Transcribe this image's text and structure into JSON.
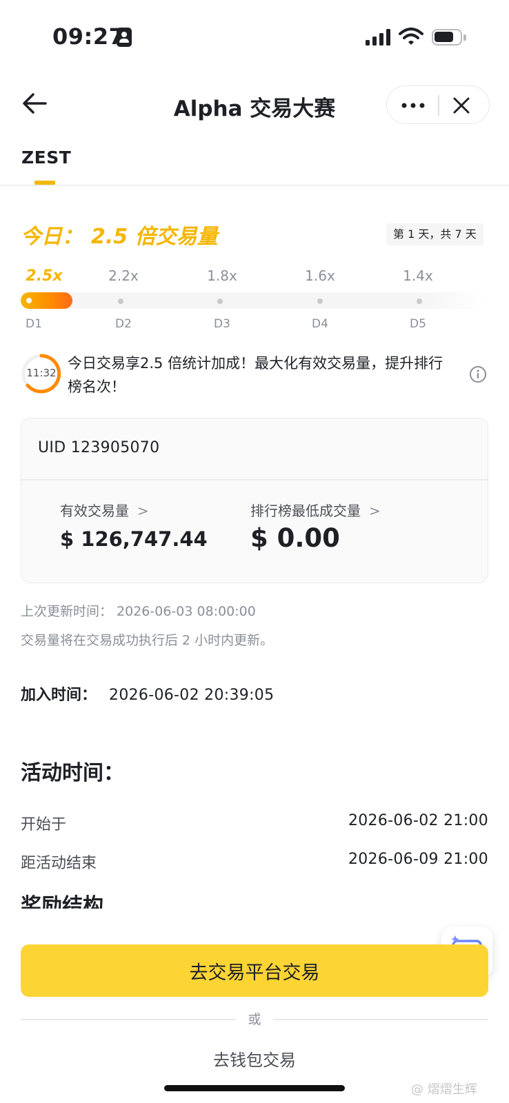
{
  "status_bar": {
    "time": "09:27"
  },
  "nav": {
    "title": "Alpha 交易大赛"
  },
  "tabs": [
    {
      "label": "ZEST",
      "active": true
    }
  ],
  "today": {
    "label": "今日：",
    "multiplier": "2.5 倍交易量",
    "day_badge": "第 1 天，共 7 天",
    "progress": 0.11
  },
  "steps": [
    {
      "mult": "2.5x",
      "day": "D1",
      "active": true
    },
    {
      "mult": "2.2x",
      "day": "D2",
      "active": false
    },
    {
      "mult": "1.8x",
      "day": "D3",
      "active": false
    },
    {
      "mult": "1.6x",
      "day": "D4",
      "active": false
    },
    {
      "mult": "1.4x",
      "day": "D5",
      "active": false
    }
  ],
  "notice": {
    "timer": "11:32",
    "text": "今日交易享2.5 倍统计加成！最大化有效交易量，提升排行榜名次！"
  },
  "stats": {
    "uid": "UID 123905070",
    "volume_label": "有效交易量",
    "volume_value": "$ 126,747.44",
    "min_label": "排行榜最低成交量",
    "min_value": "$ 0.00"
  },
  "update": {
    "last_update": "上次更新时间：  2026-06-03 08:00:00",
    "note": "交易量将在交易成功执行后 2 小时内更新。"
  },
  "joined": {
    "label": "加入时间：",
    "value": "2026-06-02 20:39:05"
  },
  "activity": {
    "title": "活动时间：",
    "start_label": "开始于",
    "start_value": "2026-06-02 21:00",
    "end_label": "距活动结束",
    "end_value": "2026-06-09 21:00"
  },
  "next_section": "奖励结构",
  "actions": {
    "primary": "去交易平台交易",
    "or": "或",
    "secondary": "去钱包交易"
  },
  "watermark": "@ 熠熠生辉",
  "colors": {
    "brand_yellow": "#FCD535",
    "accent_orange": "#FF8A00",
    "accent_gold": "#F5B600"
  }
}
